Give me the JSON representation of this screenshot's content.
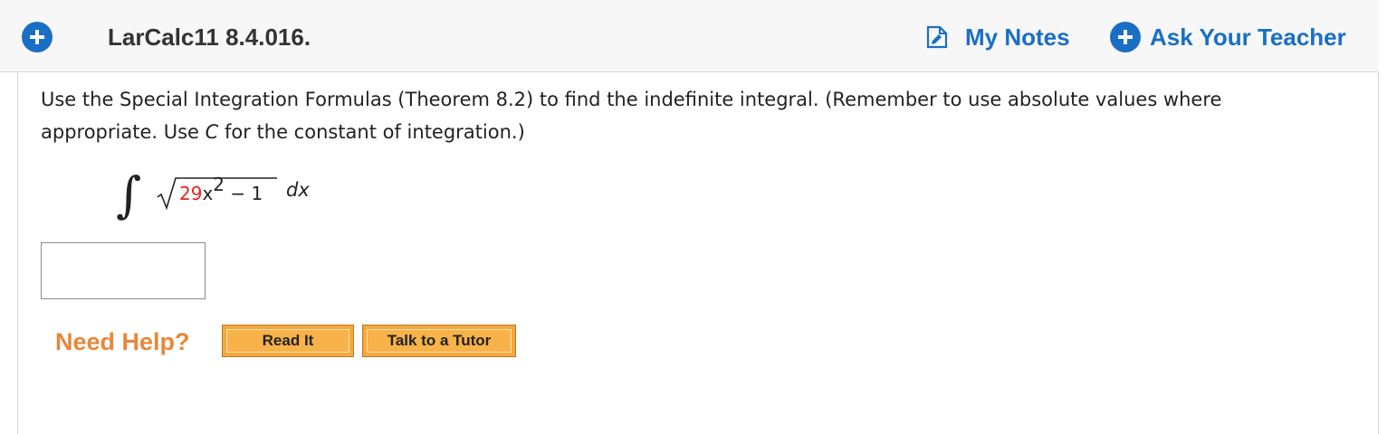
{
  "header": {
    "problem_title": "LarCalc11 8.4.016.",
    "my_notes_label": "My Notes",
    "ask_teacher_label": "Ask Your Teacher"
  },
  "question": {
    "instructions_part1": "Use the Special Integration Formulas (Theorem 8.2) to find the indefinite integral. (Remember to use absolute values where appropriate. Use ",
    "instructions_var": "C",
    "instructions_part2": " for the constant of integration.)",
    "integral": {
      "coefficient": "29",
      "variable": "x",
      "exponent": "2",
      "rest": " − 1",
      "differential": "dx"
    },
    "answer_value": ""
  },
  "help": {
    "label": "Need Help?",
    "read_it_label": "Read It",
    "tutor_label": "Talk to a Tutor"
  },
  "colors": {
    "link_blue": "#1a6fc4",
    "need_help_orange": "#e6883a",
    "button_orange": "#f6a83a",
    "coefficient_red": "#e2261c"
  }
}
